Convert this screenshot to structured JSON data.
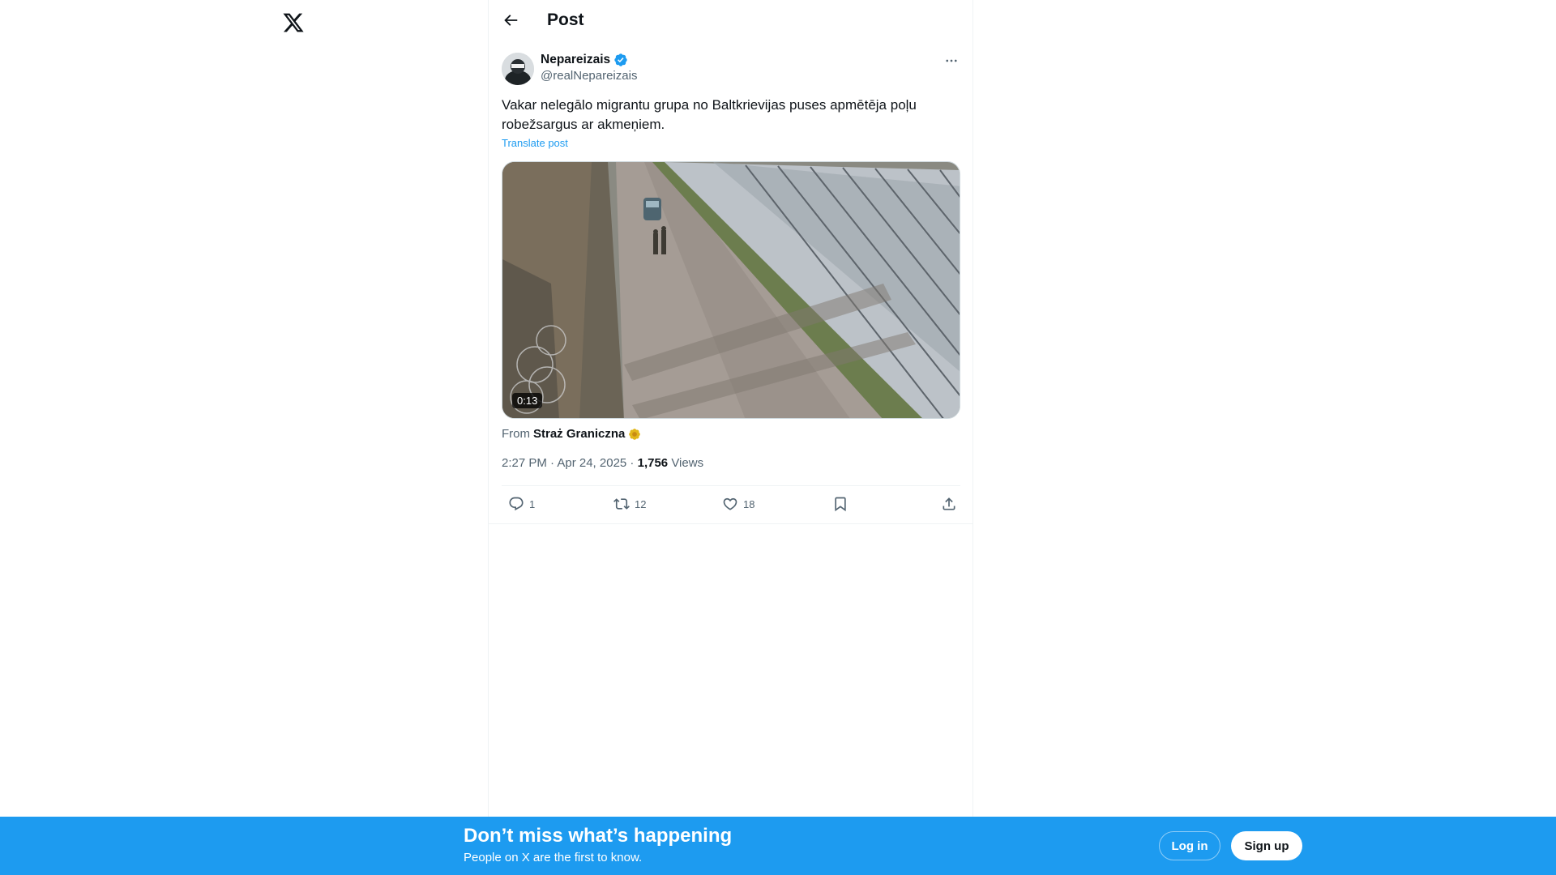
{
  "header": {
    "title": "Post"
  },
  "post": {
    "author": {
      "name": "Nepareizais",
      "handle": "@realNepareizais",
      "verified": true
    },
    "text": "Vakar nelegālo migrantu grupa no Baltkrievijas puses apmētēja poļu robežsargus ar akmeņiem.",
    "translate_label": "Translate post",
    "media": {
      "type": "video",
      "duration": "0:13"
    },
    "source": {
      "prefix": "From",
      "name": "Straż Graniczna",
      "badge": "gold-verified"
    },
    "timestamp": "2:27 PM · Apr 24, 2025",
    "separator": " · ",
    "views_count": "1,756",
    "views_label": "Views"
  },
  "actions": {
    "reply_count": "1",
    "repost_count": "12",
    "like_count": "18"
  },
  "banner": {
    "title": "Don’t miss what’s happening",
    "subtitle": "People on X are the first to know.",
    "login_label": "Log in",
    "signup_label": "Sign up"
  },
  "colors": {
    "accent": "#1d9bf0",
    "text": "#0f1419",
    "secondary": "#536471"
  }
}
